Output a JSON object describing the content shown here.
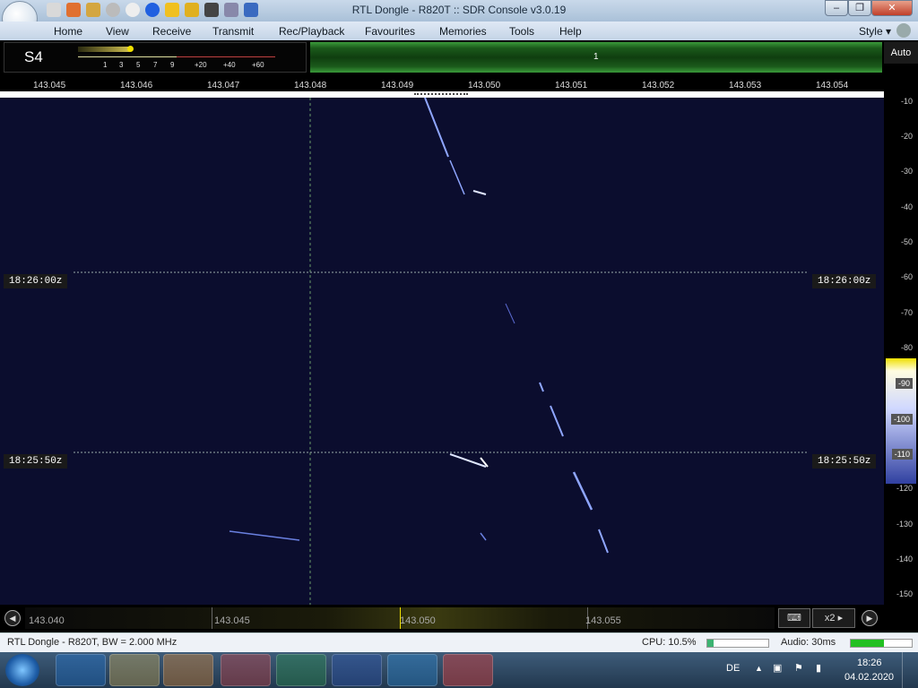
{
  "window": {
    "title": "RTL Dongle - R820T :: SDR Console v3.0.19"
  },
  "menu": [
    "Home",
    "View",
    "Receive",
    "Transmit",
    "Rec/Playback",
    "Favourites",
    "Memories",
    "Tools",
    "Help"
  ],
  "style_menu": "Style",
  "smeter": {
    "label": "S4",
    "scale": [
      "1",
      "3",
      "5",
      "7",
      "9",
      "+20",
      "+40",
      "+60"
    ]
  },
  "band": {
    "marker": "1"
  },
  "auto_label": "Auto",
  "freq_ticks": [
    "143.045",
    "143.046",
    "143.047",
    "143.048",
    "143.049",
    "143.050",
    "143.051",
    "143.052",
    "143.053",
    "143.054"
  ],
  "db_scale": [
    "-10",
    "-20",
    "-30",
    "-40",
    "-50",
    "-60",
    "-70",
    "-80",
    "-90",
    "-100",
    "-110",
    "-120",
    "-130",
    "-140",
    "-150"
  ],
  "time_marks": [
    "18:26:00z",
    "18:25:50z"
  ],
  "pan": {
    "labels": [
      "143.040",
      "143.045",
      "143.050",
      "143.055"
    ],
    "zoom": "x2"
  },
  "status": {
    "left": "RTL Dongle - R820T, BW = 2.000 MHz",
    "cpu": "CPU: 10.5%",
    "audio": "Audio: 30ms",
    "cpu_level": 0.105,
    "audio_level": 0.55
  },
  "taskbar": {
    "lang": "DE",
    "time": "18:26",
    "date": "04.02.2020"
  },
  "colors": {
    "waterfall_bg": "#0b0d2e",
    "band_green": "#1b5a1b",
    "accent_yellow": "#f0e000"
  }
}
